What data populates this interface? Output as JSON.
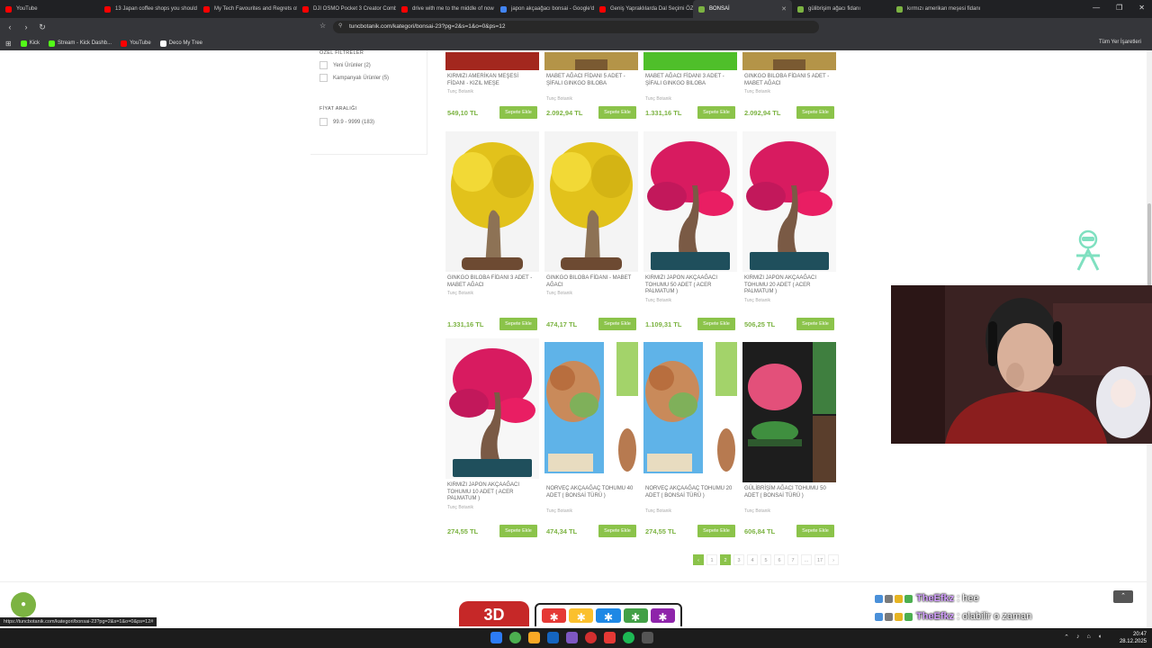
{
  "browser": {
    "tabs": [
      {
        "title": "YouTube",
        "color": "#ff0000"
      },
      {
        "title": "13 Japan coffee shops you should",
        "color": "#ff0000"
      },
      {
        "title": "My Tech Favourites and Regrets of",
        "color": "#ff0000"
      },
      {
        "title": "DJI OSMO Pocket 3 Creator Combo",
        "color": "#ff0000"
      },
      {
        "title": "drive with me to the middle of now",
        "color": "#ff0000"
      },
      {
        "title": "japon akçaağacı bonsai - Google'd",
        "color": "#4285f4"
      },
      {
        "title": "Geniş Yapraklılarda Dal Seçimi ÖZE",
        "color": "#ff0000"
      },
      {
        "title": "BONSAİ",
        "color": "#7cb342",
        "active": true
      },
      {
        "title": "gülibrişim ağacı fidanı",
        "color": "#7cb342"
      },
      {
        "title": "kırmızı amerikan meşesi fidanı",
        "color": "#7cb342"
      }
    ],
    "url": "tuncbotanik.com/kategori/bonsai-23?pg=2&s=1&o=0&ps=12",
    "bookmarks": [
      {
        "label": "Kick",
        "color": "#53fc18"
      },
      {
        "label": "Stream - Kick Dashb...",
        "color": "#53fc18"
      },
      {
        "label": "YouTube",
        "color": "#ff0000"
      },
      {
        "label": "Deco My Tree",
        "color": "#ffffff"
      }
    ],
    "bookmarks_right": "Tüm Yer İşaretleri",
    "status_url": "https://tuncbotanik.com/kategori/bonsai-23?pg=2&s=1&o=0&ps=12#"
  },
  "sidebar": {
    "special_title": "ÖZEL FİLTRELER",
    "special_options": [
      "Yeni Ürünler (2)",
      "Kampanyalı Ürünler (5)"
    ],
    "price_title": "FİYAT ARALIĞI",
    "price_options": [
      "99.9 - 9999 (183)"
    ]
  },
  "products": [
    {
      "name": "KIRMIZI AMERİKAN MEŞESİ FİDANI - KIZIL MEŞE",
      "brand": "Tunç Botanik",
      "price": "549,10 TL",
      "cart": "Sepete Ekle",
      "art": "redtop"
    },
    {
      "name": "MABET AĞACI FİDANI 5 ADET - ŞİFALI GINKGO BILOBA",
      "brand": "Tunç Botanik",
      "price": "2.092,94 TL",
      "cart": "Sepete Ekle",
      "art": "oliveTop"
    },
    {
      "name": "MABET AĞACI FİDANI 3 ADET - ŞİFALI GINKGO BILOBA",
      "brand": "Tunç Botanik",
      "price": "1.331,16 TL",
      "cart": "Sepete Ekle",
      "art": "greentop"
    },
    {
      "name": "GINKGO BILOBA FİDANI 5 ADET - MABET AĞACI",
      "brand": "Tunç Botanik",
      "price": "2.092,94 TL",
      "cart": "Sepete Ekle",
      "art": "oliveTop"
    },
    {
      "name": "GINKGO BILOBA FİDANI 3 ADET - MABET AĞACI",
      "brand": "Tunç Botanik",
      "price": "1.331,16 TL",
      "cart": "Sepete Ekle",
      "art": "yellow"
    },
    {
      "name": "GINKGO BILOBA FİDANI - MABET AĞACI",
      "brand": "Tunç Botanik",
      "price": "474,17 TL",
      "cart": "Sepete Ekle",
      "art": "yellow"
    },
    {
      "name": "KIRMIZI JAPON AKÇAAĞACI TOHUMU 50 ADET ( Acer Palmatum )",
      "brand": "Tunç Botanik",
      "price": "1.109,31 TL",
      "cart": "Sepete Ekle",
      "art": "red"
    },
    {
      "name": "KIRMIZI JAPON AKÇAAĞACI TOHUMU 20 ADET ( Acer Palmatum )",
      "brand": "Tunç Botanik",
      "price": "506,25 TL",
      "cart": "Sepete Ekle",
      "art": "red"
    },
    {
      "name": "KIRMIZI JAPON AKÇAAĞACI TOHUMU 10 ADET ( Acer Palmatum )",
      "brand": "Tunç Botanik",
      "price": "274,55 TL",
      "cart": "Sepete Ekle",
      "art": "red"
    },
    {
      "name": "NORVEÇ AKÇAAĞAÇ TOHUMU 40 ADET ( BONSAİ TÜRÜ )",
      "brand": "Tunç Botanik",
      "price": "474,34 TL",
      "cart": "Sepete Ekle",
      "art": "norway"
    },
    {
      "name": "NORVEÇ AKÇAAĞAÇ TOHUMU 20 ADET ( BONSAİ TÜRÜ )",
      "brand": "Tunç Botanik",
      "price": "274,55 TL",
      "cart": "Sepete Ekle",
      "art": "norway"
    },
    {
      "name": "GÜLİBRİŞİM AĞACI TOHUMU 50 ADET ( BONSAİ TÜRÜ )",
      "brand": "Tunç Botanik",
      "price": "606,84 TL",
      "cart": "Sepete Ekle",
      "art": "mimosa"
    }
  ],
  "pagination": {
    "prev": "‹",
    "pages": [
      "1",
      "2",
      "3",
      "4",
      "5",
      "6",
      "7",
      "...",
      "17"
    ],
    "active": "2",
    "next": "›"
  },
  "footer": {
    "logo_text": "3D",
    "chat_icon": "chat-bubble-icon",
    "scroll_top_icon": "chevron-up-icon"
  },
  "stream_chat": [
    {
      "user": "TheEfkz",
      "message": ": hee"
    },
    {
      "user": "TheEfkz",
      "message": ": olabilir o zaman"
    }
  ],
  "clock": {
    "time": "20:47",
    "date": "28.12.2025"
  }
}
